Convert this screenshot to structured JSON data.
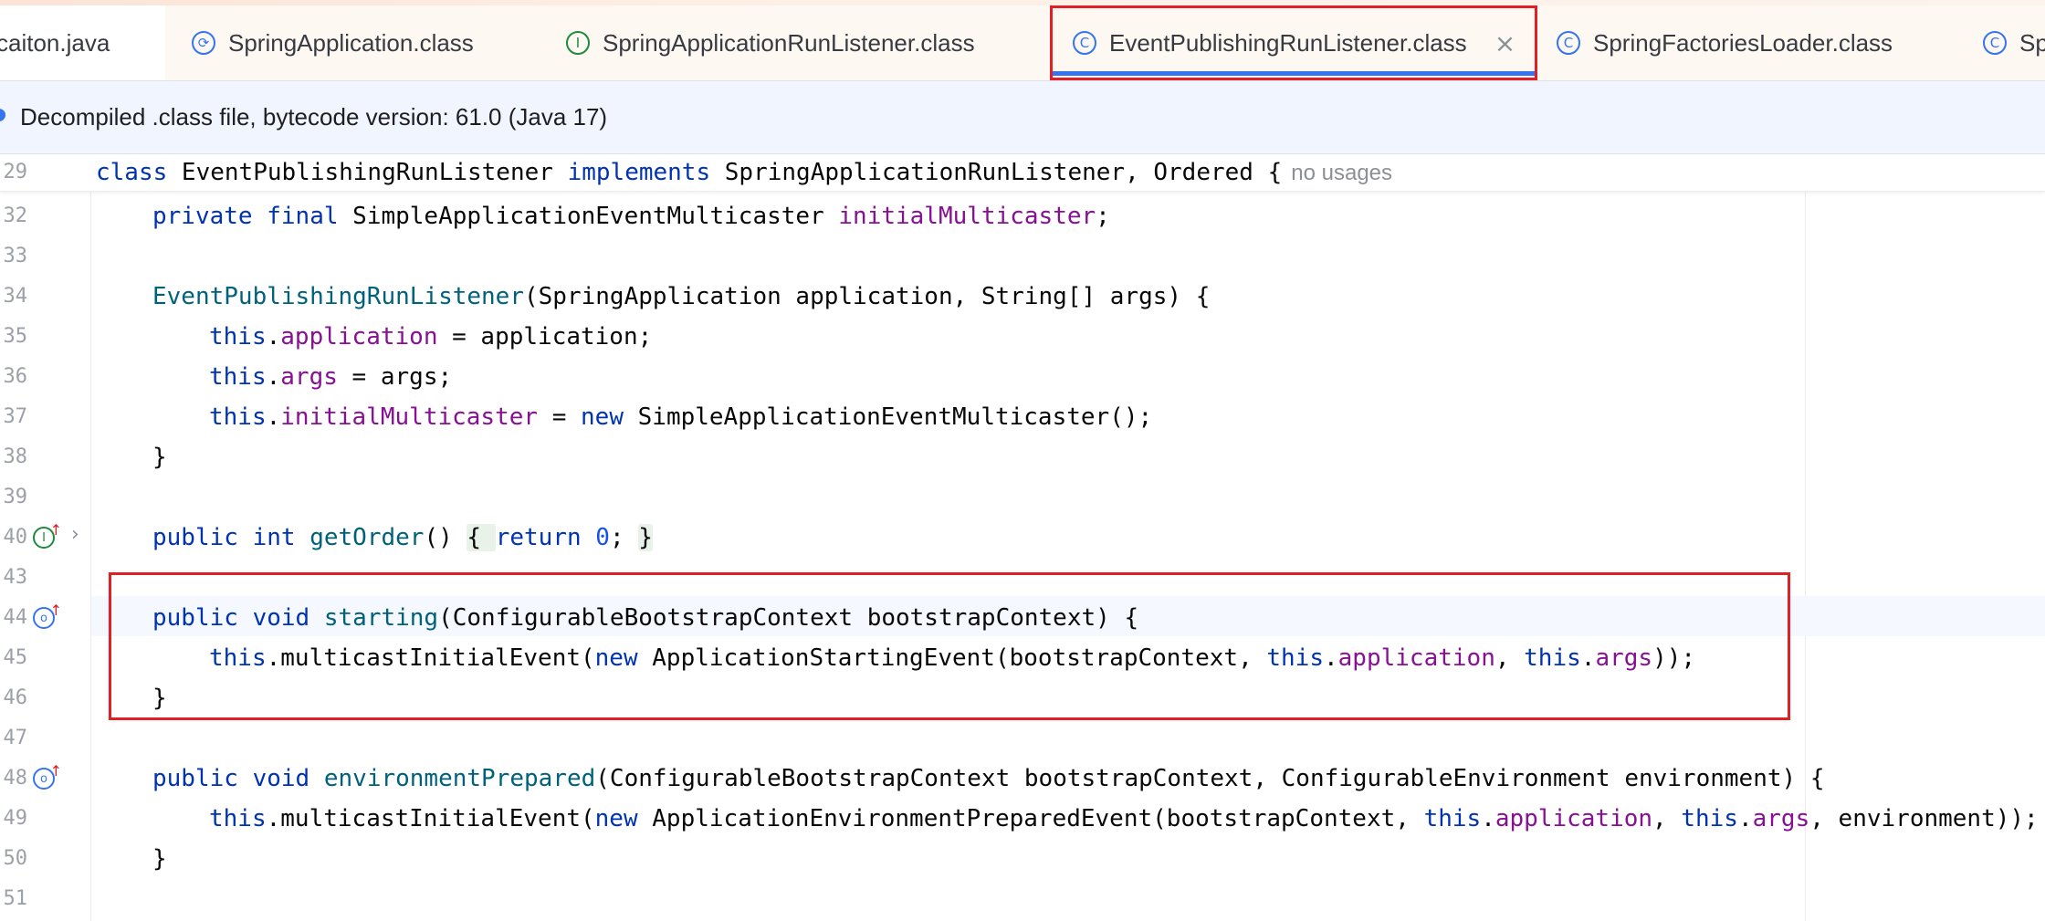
{
  "tabs": [
    {
      "label": "caiton.java",
      "icon": "none"
    },
    {
      "label": "SpringApplication.class",
      "icon": "spring-app-icon"
    },
    {
      "label": "SpringApplicationRunListener.class",
      "icon": "interface-icon"
    },
    {
      "label": "EventPublishingRunListener.class",
      "icon": "class-icon",
      "active": true,
      "close": "×"
    },
    {
      "label": "SpringFactoriesLoader.class",
      "icon": "class-icon"
    },
    {
      "label": "Sp",
      "icon": "class-icon"
    }
  ],
  "banner": {
    "text": "Decompiled .class file, bytecode version: 61.0 (Java 17)"
  },
  "sticky": {
    "line_no": "29",
    "tokens": [
      "class",
      " EventPublishingRunListener ",
      "implements",
      " SpringApplicationRunListener, Ordered {"
    ],
    "hint": "no usages"
  },
  "lines": [
    {
      "no": "32",
      "parts": [
        "private",
        " ",
        "final",
        " SimpleApplicationEventMulticaster ",
        "initialMulticaster",
        ";"
      ]
    },
    {
      "no": "33",
      "parts": []
    },
    {
      "no": "34",
      "parts": [
        "EventPublishingRunListener",
        "(SpringApplication application, String[] args) {"
      ]
    },
    {
      "no": "35",
      "parts": [
        "this",
        ".",
        "application",
        " = application;"
      ]
    },
    {
      "no": "36",
      "parts": [
        "this",
        ".",
        "args",
        " = args;"
      ]
    },
    {
      "no": "37",
      "parts": [
        "this",
        ".",
        "initialMulticaster",
        " = ",
        "new",
        " SimpleApplicationEventMulticaster();"
      ]
    },
    {
      "no": "38",
      "parts": [
        "}"
      ]
    },
    {
      "no": "39",
      "parts": []
    },
    {
      "no": "40",
      "parts": [
        "public",
        " ",
        "int",
        " ",
        "getOrder",
        "() ",
        "{ ",
        "return",
        " ",
        "0",
        "; ",
        "}"
      ]
    },
    {
      "no": "43",
      "parts": []
    },
    {
      "no": "44",
      "parts": [
        "public",
        " ",
        "void",
        " ",
        "starting",
        "(ConfigurableBootstrapContext bootstrapContext) {"
      ]
    },
    {
      "no": "45",
      "parts": [
        "this",
        ".multicastInitialEvent(",
        "new",
        " ApplicationStartingEvent(bootstrapContext, ",
        "this",
        ".",
        "application",
        ", ",
        "this",
        ".",
        "args",
        "));"
      ]
    },
    {
      "no": "46",
      "parts": [
        "}"
      ]
    },
    {
      "no": "47",
      "parts": []
    },
    {
      "no": "48",
      "parts": [
        "public",
        " ",
        "void",
        " ",
        "environmentPrepared",
        "(ConfigurableBootstrapContext bootstrapContext, ConfigurableEnvironment environment) {"
      ]
    },
    {
      "no": "49",
      "parts": [
        "this",
        ".multicastInitialEvent(",
        "new",
        " ApplicationEnvironmentPreparedEvent(bootstrapContext, ",
        "this",
        ".",
        "application",
        ", ",
        "this",
        ".",
        "args",
        ", environment));"
      ]
    },
    {
      "no": "50",
      "parts": [
        "}"
      ]
    },
    {
      "no": "51",
      "parts": []
    }
  ],
  "colors": {
    "keyword": "#0033b3",
    "field": "#871094",
    "method": "#00627a",
    "number": "#1750eb",
    "highlight": "#e01f26",
    "accent": "#3574f0"
  }
}
